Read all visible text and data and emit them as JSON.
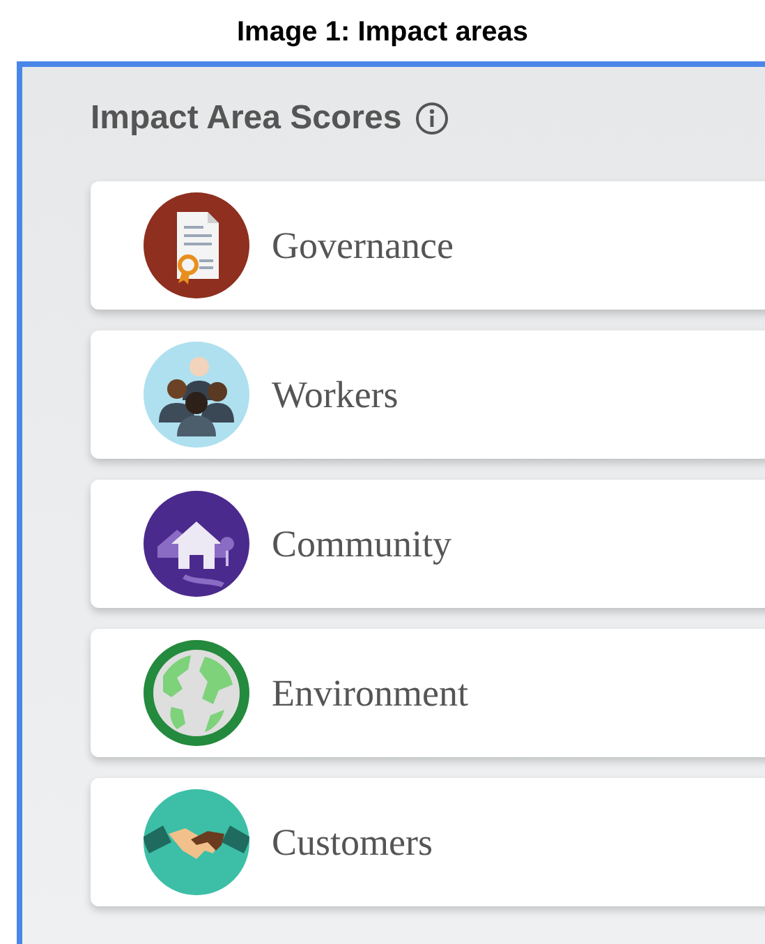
{
  "caption": "Image 1: Impact areas",
  "panel": {
    "title": "Impact Area Scores",
    "info_icon": true,
    "areas": [
      {
        "label": "Governance",
        "kind": "document"
      },
      {
        "label": "Workers",
        "kind": "people"
      },
      {
        "label": "Community",
        "kind": "house"
      },
      {
        "label": "Environment",
        "kind": "globe"
      },
      {
        "label": "Customers",
        "kind": "handshake"
      }
    ]
  }
}
